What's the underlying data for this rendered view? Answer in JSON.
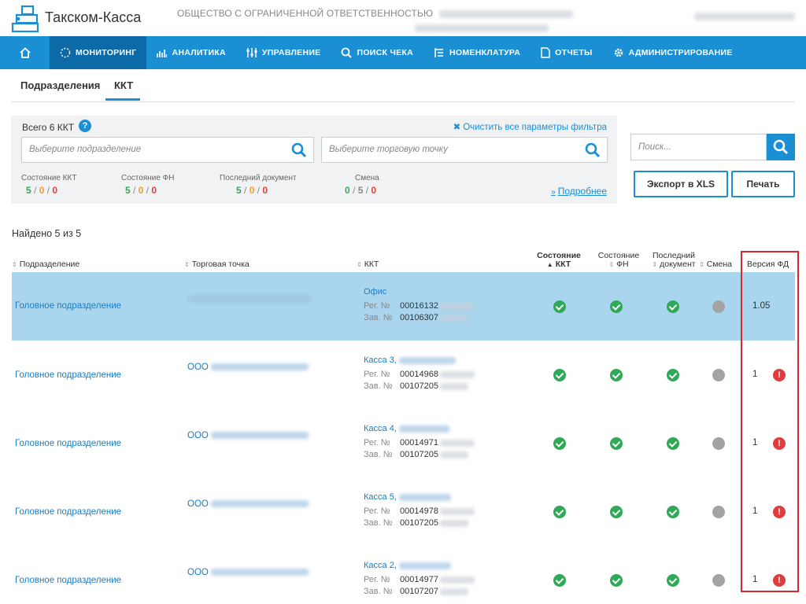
{
  "header": {
    "app_title": "Такском-Касса",
    "org_name": "ОБЩЕСТВО С ОГРАНИЧЕННОЙ ОТВЕТСТВЕННОСТЬЮ"
  },
  "nav": {
    "items": [
      {
        "label": "МОНИТОРИНГ",
        "icon": "monitoring-icon"
      },
      {
        "label": "АНАЛИТИКА",
        "icon": "chart-icon"
      },
      {
        "label": "УПРАВЛЕНИЕ",
        "icon": "sliders-icon"
      },
      {
        "label": "ПОИСК ЧЕКА",
        "icon": "search-icon"
      },
      {
        "label": "НОМЕНКЛАТУРА",
        "icon": "list-icon"
      },
      {
        "label": "ОТЧЕТЫ",
        "icon": "document-icon"
      },
      {
        "label": "АДМИНИСТРИРОВАНИЕ",
        "icon": "gear-icon"
      }
    ]
  },
  "tabs": [
    "Подразделения",
    "ККТ"
  ],
  "filter": {
    "total": "Всего 6 ККТ",
    "help": "?",
    "clear": "Очистить все параметры фильтра",
    "division_placeholder": "Выберите подразделение",
    "point_placeholder": "Выберите торговую точку",
    "more": "Подробнее",
    "stats": [
      {
        "label": "Состояние ККТ",
        "a": "5",
        "b": "0",
        "c": "0"
      },
      {
        "label": "Состояние ФН",
        "a": "5",
        "b": "0",
        "c": "0"
      },
      {
        "label": "Последний документ",
        "a": "5",
        "b": "0",
        "c": "0"
      },
      {
        "label": "Смена",
        "a": "0",
        "b": "5",
        "c": "0"
      }
    ]
  },
  "search": {
    "placeholder": "Поиск..."
  },
  "buttons": {
    "export": "Экспорт в XLS",
    "print": "Печать"
  },
  "found": "Найдено 5 из 5",
  "table": {
    "headers": {
      "division": "Подразделение",
      "point": "Торговая точка",
      "kkt": "ККТ",
      "kkt_state_1": "Состояние",
      "kkt_state_2": "ККТ",
      "fn_state_1": "Состояние",
      "fn_state_2": "ФН",
      "last_doc_1": "Последний",
      "last_doc_2": "документ",
      "shift": "Смена",
      "fd_version": "Версия ФД"
    },
    "reg_label": "Рег. №",
    "serial_label": "Зав. №",
    "rows": [
      {
        "division": "Головное подразделение",
        "point": "",
        "kkt_name": "Офис",
        "reg": "00016132",
        "serial": "00106307",
        "fd": "1.05",
        "warn": false
      },
      {
        "division": "Головное подразделение",
        "point": "ООО",
        "kkt_name": "Касса 3,",
        "reg": "00014968",
        "serial": "00107205",
        "fd": "1",
        "warn": true
      },
      {
        "division": "Головное подразделение",
        "point": "ООО",
        "kkt_name": "Касса 4,",
        "reg": "00014971",
        "serial": "00107205",
        "fd": "1",
        "warn": true
      },
      {
        "division": "Головное подразделение",
        "point": "ООО",
        "kkt_name": "Касса 5,",
        "reg": "00014978",
        "serial": "00107205",
        "fd": "1",
        "warn": true
      },
      {
        "division": "Головное подразделение",
        "point": "ООО",
        "kkt_name": "Касса 2,",
        "reg": "00014977",
        "serial": "00107207",
        "fd": "1",
        "warn": true
      }
    ]
  },
  "colors": {
    "accent": "#1a8fd3",
    "nav_active": "#0d6aa8",
    "ok": "#2fa858",
    "warn": "#e03c3c",
    "highlight": "#a9d6ee",
    "annotation": "#d7282f"
  }
}
